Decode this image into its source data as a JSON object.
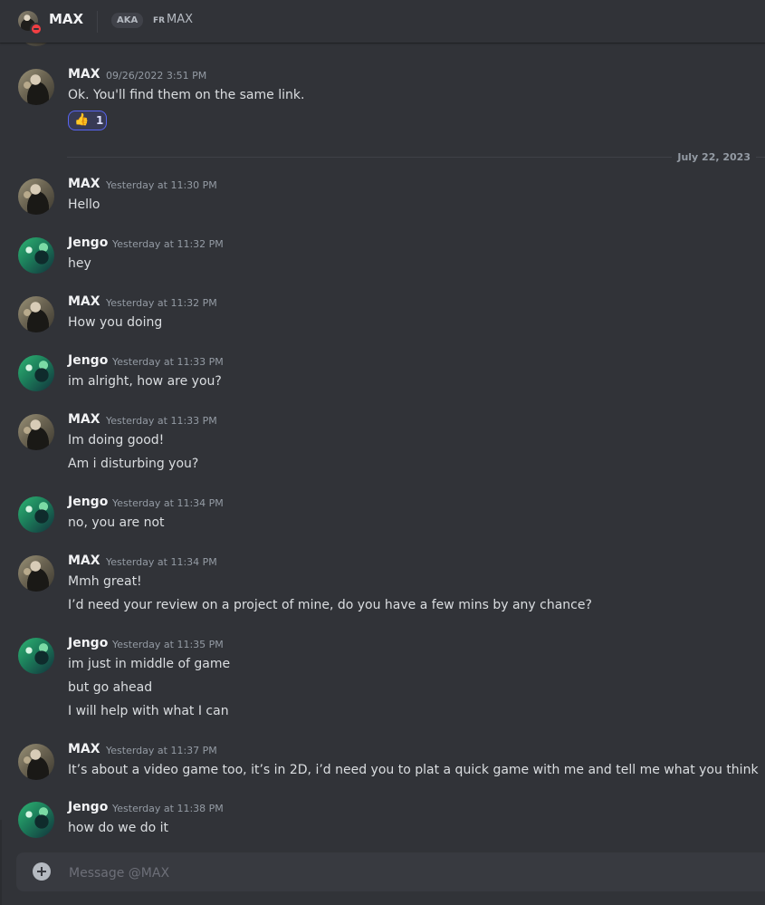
{
  "header": {
    "title": "MAX",
    "aka_badge": "AKA",
    "aka_prefix": "FR",
    "aka_name": "MAX",
    "status": "do-not-disturb",
    "status_color": "#f23f43"
  },
  "date_divider": "July 22, 2023",
  "messages": [
    {
      "author": "MAX",
      "time": "09/26/2022 3:51 PM",
      "lines": [
        "Ok. You'll find them on the same link."
      ],
      "reaction": {
        "emoji": "👍",
        "count": "1"
      }
    },
    {
      "author": "MAX",
      "time": "Yesterday at 11:30 PM",
      "lines": [
        "Hello"
      ]
    },
    {
      "author": "Jengo",
      "time": "Yesterday at 11:32 PM",
      "lines": [
        "hey"
      ]
    },
    {
      "author": "MAX",
      "time": "Yesterday at 11:32 PM",
      "lines": [
        "How you doing"
      ]
    },
    {
      "author": "Jengo",
      "time": "Yesterday at 11:33 PM",
      "lines": [
        "im alright, how are you?"
      ]
    },
    {
      "author": "MAX",
      "time": "Yesterday at 11:33 PM",
      "lines": [
        "Im doing good!",
        "Am i disturbing you?"
      ]
    },
    {
      "author": "Jengo",
      "time": "Yesterday at 11:34 PM",
      "lines": [
        "no, you are not"
      ]
    },
    {
      "author": "MAX",
      "time": "Yesterday at 11:34 PM",
      "lines": [
        "Mmh great!",
        "I’d need your review on a project of mine, do you have a few mins by any chance?"
      ]
    },
    {
      "author": "Jengo",
      "time": "Yesterday at 11:35 PM",
      "lines": [
        "im just in middle of game",
        "but go ahead",
        "I will help with what I can"
      ]
    },
    {
      "author": "MAX",
      "time": "Yesterday at 11:37 PM",
      "lines": [
        "It’s about a video game too, it’s in 2D, i’d need you to plat a quick game with me and tell me what you think"
      ]
    },
    {
      "author": "Jengo",
      "time": "Yesterday at 11:38 PM",
      "lines": [
        "how do we do it"
      ]
    }
  ],
  "composer": {
    "placeholder": "Message @MAX"
  },
  "colors": {
    "background": "#313338",
    "accent": "#5865f2",
    "muted": "#949ba4"
  }
}
